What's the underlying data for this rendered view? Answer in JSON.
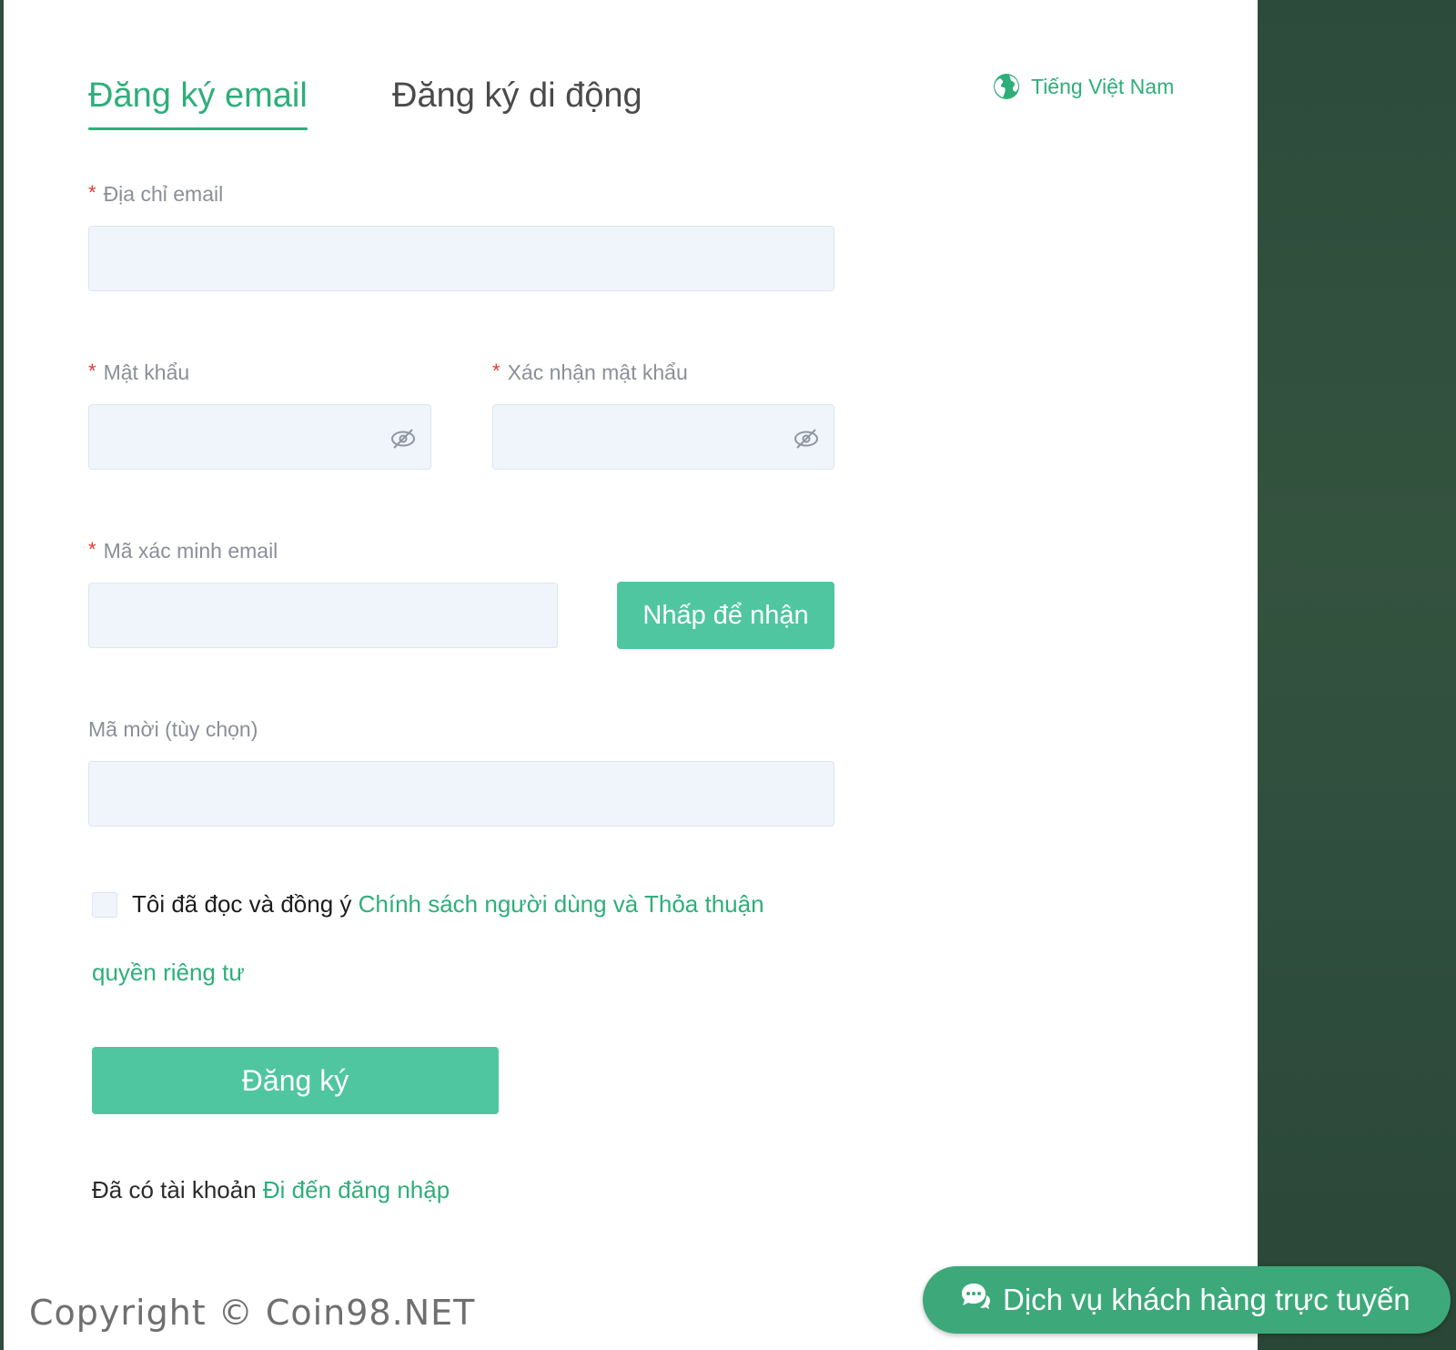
{
  "tabs": {
    "email": "Đăng ký email",
    "mobile": "Đăng ký di động"
  },
  "language": {
    "label": "Tiếng Việt Nam",
    "icon": "globe-icon"
  },
  "form": {
    "email_label": "Địa chỉ email",
    "email_value": "",
    "password_label": "Mật khẩu",
    "password_value": "",
    "confirm_label": "Xác nhận mật khẩu",
    "confirm_value": "",
    "code_label": "Mã xác minh email",
    "code_value": "",
    "get_code_button": "Nhấp để nhận",
    "invite_label": "Mã mời (tùy chọn)",
    "invite_value": "",
    "required_mark": "*",
    "eye_icon": "eye-off-icon"
  },
  "agreement": {
    "prefix": "Tôi đã đọc và đồng ý ",
    "link_part1": "Chính sách người dùng và Thỏa thuận",
    "link_part2": "quyền riêng tư",
    "checked": false
  },
  "submit_button": "Đăng ký",
  "login": {
    "prefix": "Đã có tài khoản ",
    "link": "Đi đến đăng nhập"
  },
  "footer": {
    "copyright": "Copyright © Coin98.NET"
  },
  "chat": {
    "label": "Dịch vụ khách hàng trực tuyến",
    "icon": "chat-bubbles-icon"
  },
  "colors": {
    "accent": "#2fae7a",
    "button": "#50c6a0",
    "chat_button": "#3da97a",
    "input_bg": "#f0f5fc",
    "background": "#2f4e3e",
    "required": "#e53935"
  }
}
